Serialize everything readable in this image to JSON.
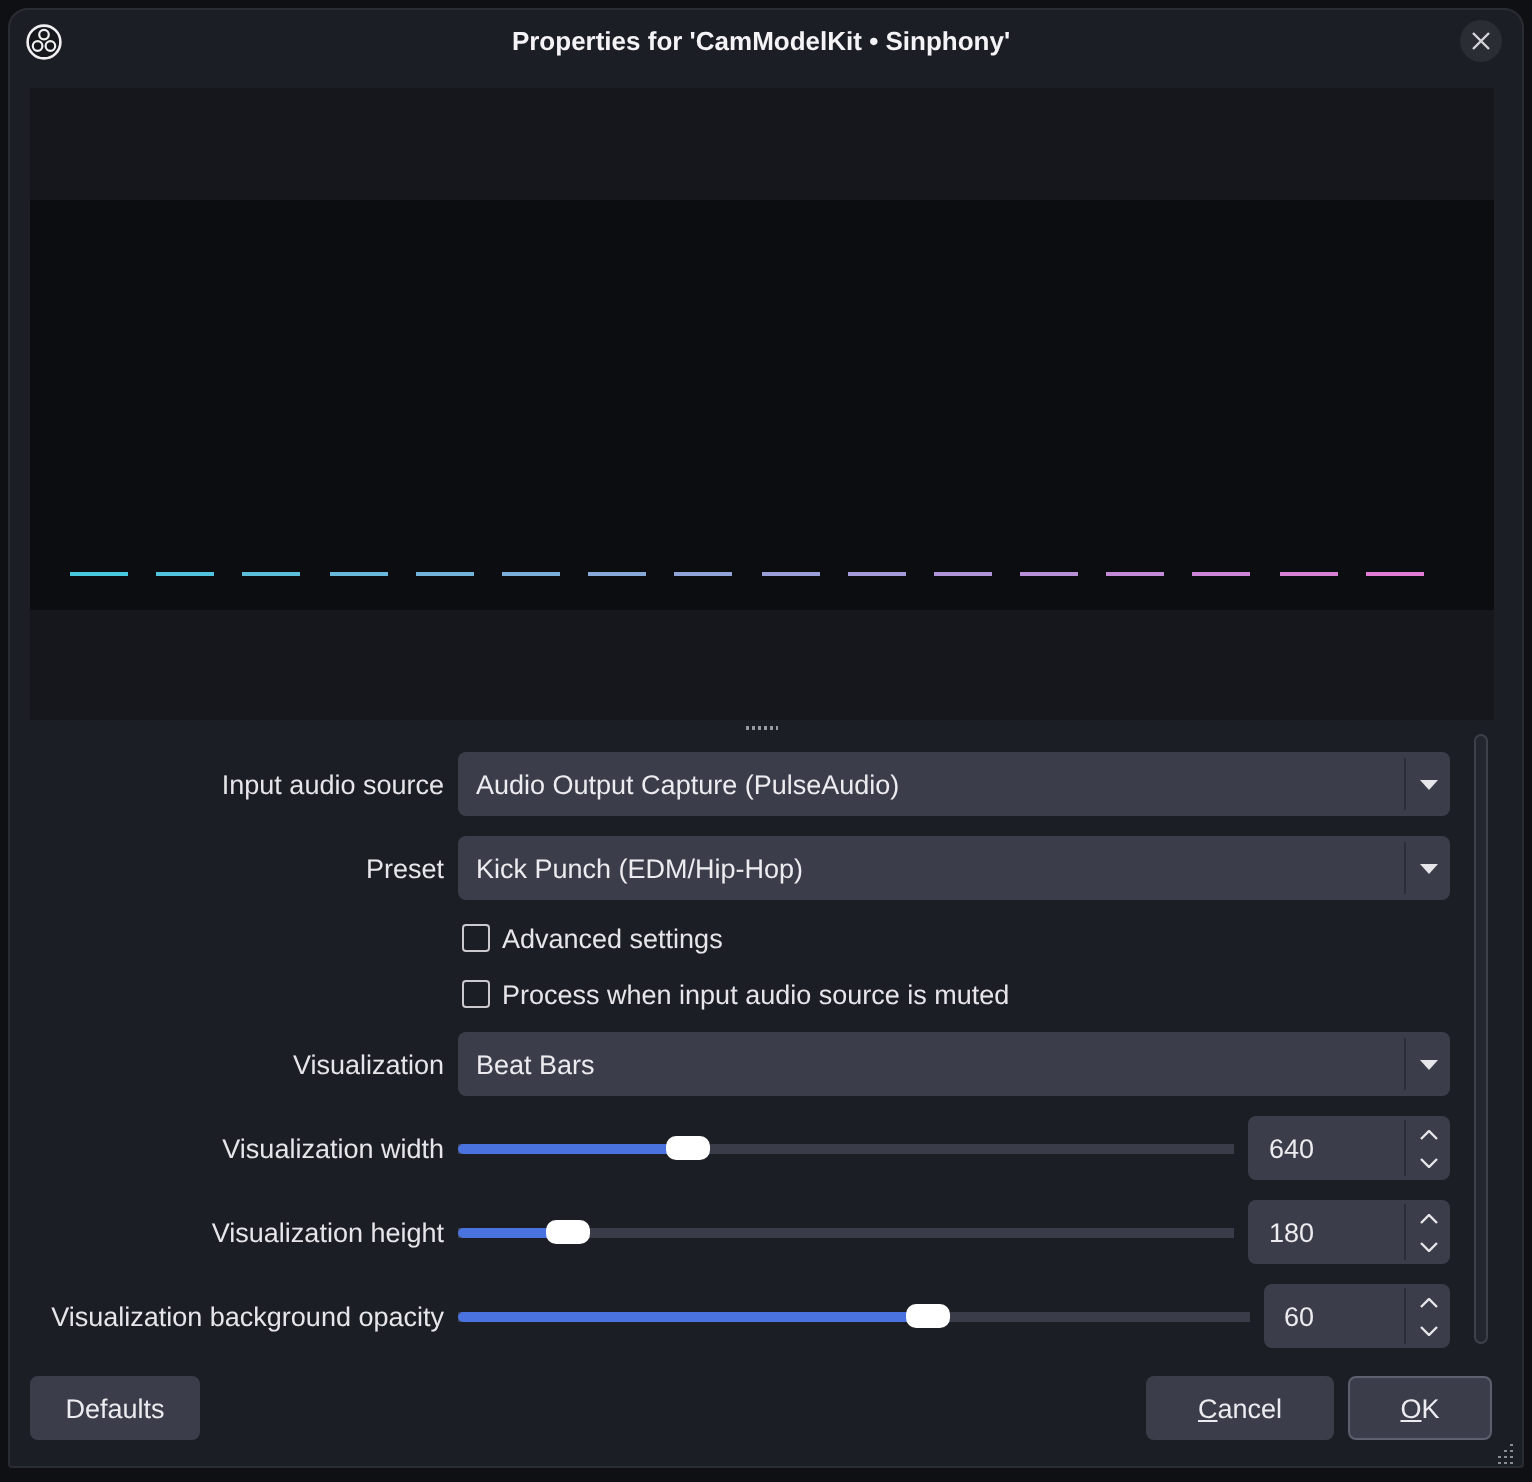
{
  "window": {
    "title": "Properties for 'CamModelKit • Sinphony'"
  },
  "form": {
    "rows": [
      {
        "kind": "dropdown",
        "label": "Input audio source",
        "value": "Audio Output Capture (PulseAudio)"
      },
      {
        "kind": "dropdown",
        "label": "Preset",
        "value": "Kick Punch (EDM/Hip-Hop)"
      },
      {
        "kind": "checkbox",
        "label": "Advanced settings",
        "checked": false
      },
      {
        "kind": "checkbox",
        "label": "Process when input audio source is muted",
        "checked": false
      },
      {
        "kind": "dropdown",
        "label": "Visualization",
        "value": "Beat Bars"
      },
      {
        "kind": "slider",
        "label": "Visualization width",
        "level": 0.285,
        "value": "640"
      },
      {
        "kind": "slider",
        "label": "Visualization height",
        "level": 0.12,
        "value": "180"
      },
      {
        "kind": "slider",
        "label": "Visualization background opacity",
        "level": 0.6,
        "value": "60"
      }
    ]
  },
  "defaults_button": {
    "label": "Defaults"
  },
  "dialog_buttons": [
    {
      "label": "Cancel",
      "mnemonic_underlined": true,
      "default": false
    },
    {
      "label": "OK",
      "mnemonic_underlined": true,
      "default": true
    }
  ]
}
